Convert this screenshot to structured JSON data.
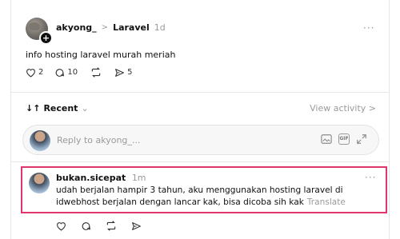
{
  "post": {
    "username": "akyong_",
    "separator": ">",
    "topic": "Laravel",
    "time": "1d",
    "more_label": "···",
    "text": "info hosting laravel murah meriah",
    "likes": "2",
    "comments": "10",
    "shares": "5"
  },
  "sort": {
    "label": "Recent",
    "chevron": "⌄",
    "arrows": "↓↑"
  },
  "view_activity": "View activity >",
  "reply": {
    "placeholder": "Reply to akyong_...",
    "tools": [
      "image-icon",
      "gif-icon",
      "expand-icon"
    ],
    "gif_label": "GIF"
  },
  "comment": {
    "username": "bukan.sicepat",
    "time": "1m",
    "more_label": "···",
    "text": "udah berjalan hampir 3 tahun, aku menggunakan hosting laravel di idwebhost berjalan dengan lancar kak, bisa dicoba sih kak",
    "translate_label": "Translate"
  },
  "colors": {
    "highlight": "#e0366b",
    "muted": "#9a9a9a"
  }
}
